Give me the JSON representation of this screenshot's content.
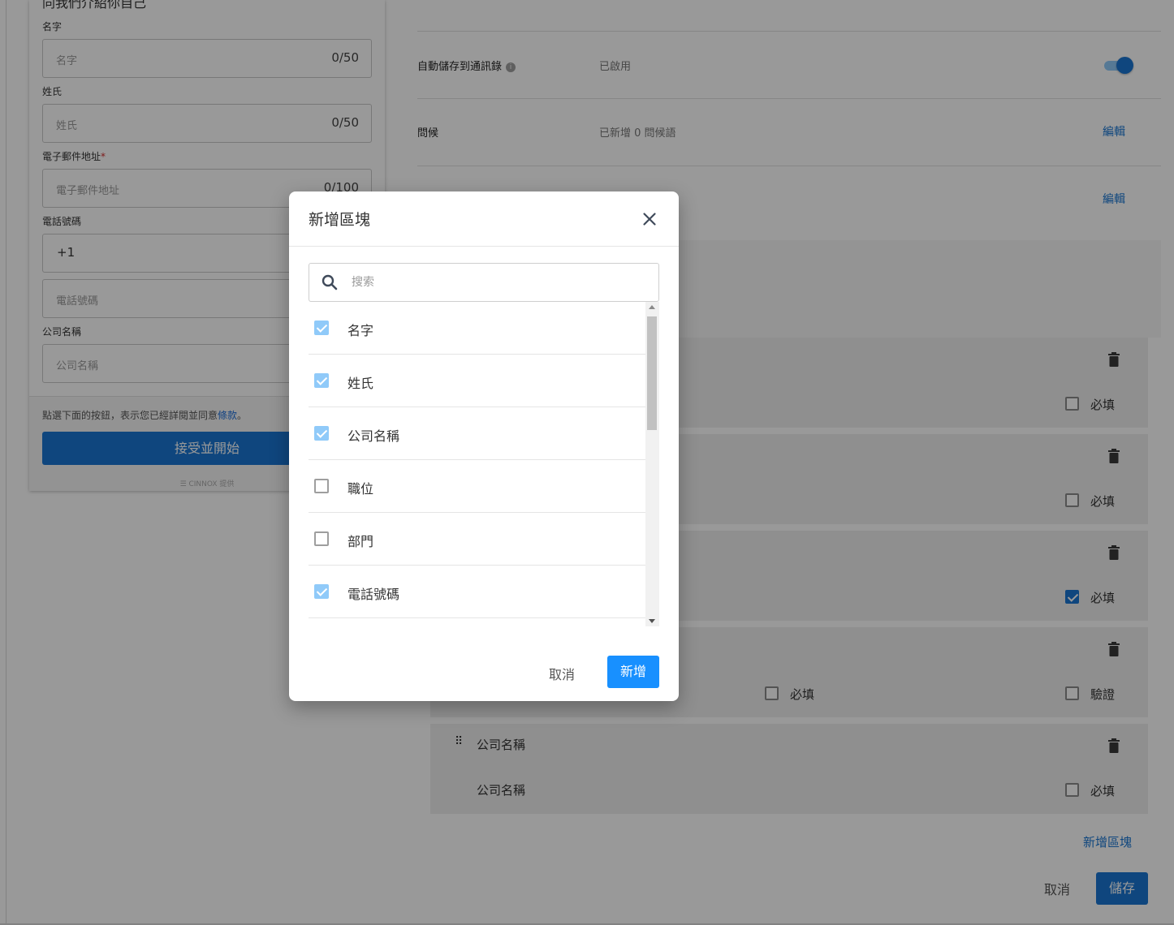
{
  "preview": {
    "heading": "同我們介紹你自己",
    "fields": [
      {
        "label": "名字",
        "placeholder": "名字",
        "counter": "0/50"
      },
      {
        "label": "姓氏",
        "placeholder": "姓氏",
        "counter": "0/50"
      },
      {
        "label": "電子郵件地址",
        "required_mark": "*",
        "placeholder": "電子郵件地址",
        "counter": "0/100"
      },
      {
        "label": "電話號碼",
        "country_code": "+1",
        "placeholder": "電話號碼"
      },
      {
        "label": "公司名稱",
        "placeholder": "公司名稱"
      }
    ],
    "terms_text": "點選下面的按鈕，表示您已經詳閱並同意",
    "terms_link": "條款",
    "terms_end": "。",
    "accept_button": "接受並開始",
    "powered_by": "☰ CINNOX 提供"
  },
  "settings": {
    "auto_save": {
      "label": "自動儲存到通訊錄",
      "value": "已啟用",
      "enabled": true
    },
    "greeting": {
      "label": "問候",
      "value": "已新增 0 問候語",
      "edit": "編輯"
    },
    "row3_edit": "編輯",
    "blocks": [
      {
        "required_label": "必填",
        "required": false
      },
      {
        "required_label": "必填",
        "required": false
      },
      {
        "required_label": "必填",
        "required": true
      },
      {
        "required_label": "必填",
        "required": false,
        "verify_label": "驗證",
        "verify": false
      },
      {
        "title": "公司名稱",
        "subtitle": "公司名稱",
        "required_label": "必填",
        "required": false
      }
    ],
    "add_block": "新增區塊",
    "cancel": "取消",
    "save": "儲存"
  },
  "dialog": {
    "title": "新增區塊",
    "search_placeholder": "搜索",
    "items": [
      {
        "label": "名字",
        "checked": true
      },
      {
        "label": "姓氏",
        "checked": true
      },
      {
        "label": "公司名稱",
        "checked": true
      },
      {
        "label": "職位",
        "checked": false
      },
      {
        "label": "部門",
        "checked": false
      },
      {
        "label": "電話號碼",
        "checked": true
      }
    ],
    "cancel": "取消",
    "add": "新增"
  },
  "colors": {
    "accent": "#1976d2",
    "dialog_primary": "#1890ff",
    "checked_light": "#90caf9"
  }
}
